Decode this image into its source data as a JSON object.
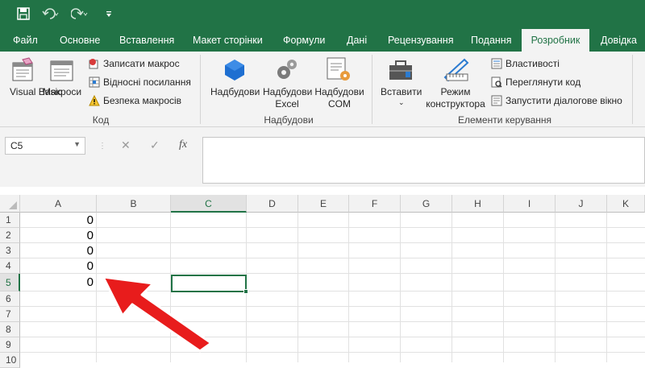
{
  "quick_access": {
    "save_icon": "save-icon",
    "undo_icon": "undo-icon",
    "redo_icon": "redo-icon",
    "customize_icon": "customize-icon"
  },
  "tabs": [
    "Файл",
    "Основне",
    "Вставлення",
    "Макет сторінки",
    "Формули",
    "Дані",
    "Рецензування",
    "Подання",
    "Розробник",
    "Довідка"
  ],
  "active_tab": "Розробник",
  "ribbon": {
    "code": {
      "visual_basic": "Visual Basic",
      "macros": "Макроси",
      "record_macro": "Записати макрос",
      "relative_refs": "Відносні посилання",
      "macro_security": "Безпека макросів",
      "group": "Код"
    },
    "addins": {
      "addins": "Надбудови",
      "excel_addins_1": "Надбудови",
      "excel_addins_2": "Excel",
      "com_addins_1": "Надбудови",
      "com_addins_2": "COM",
      "group": "Надбудови"
    },
    "controls": {
      "insert": "Вставити",
      "design_mode_1": "Режим",
      "design_mode_2": "конструктора",
      "properties": "Властивості",
      "view_code": "Переглянути код",
      "run_dialog": "Запустити діалогове вікно",
      "group": "Елементи керування"
    }
  },
  "formula_bar": {
    "name_box": "C5",
    "cancel": "✕",
    "enter": "✓",
    "fx": "fx",
    "value": ""
  },
  "columns": [
    "A",
    "B",
    "C",
    "D",
    "E",
    "F",
    "G",
    "H",
    "I",
    "J",
    "K"
  ],
  "selected_column": "C",
  "rows": [
    "1",
    "2",
    "3",
    "4",
    "5",
    "6",
    "7",
    "8",
    "9",
    "10"
  ],
  "selected_row": "5",
  "cells": {
    "A1": "0",
    "A2": "0",
    "A3": "0",
    "A4": "0",
    "A5": "0"
  },
  "colors": {
    "accent": "#217346",
    "arrow": "#e81c1c"
  }
}
